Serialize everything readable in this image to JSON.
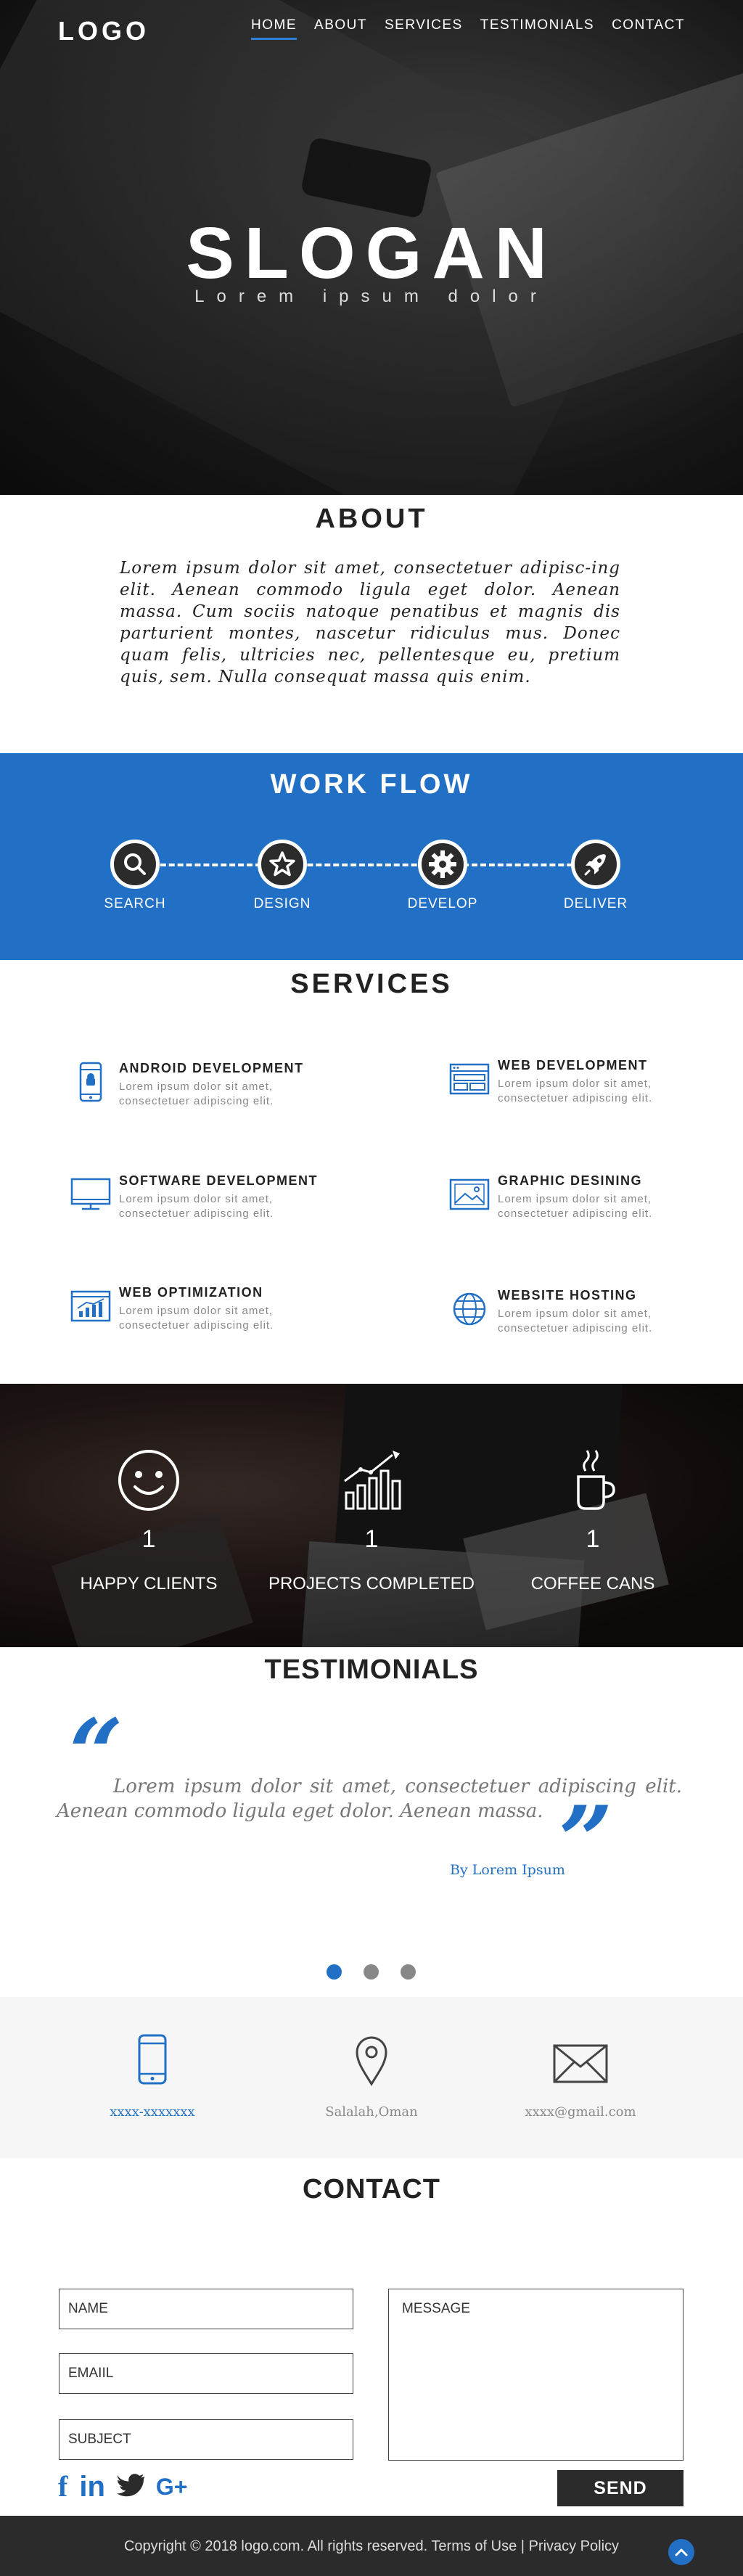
{
  "header": {
    "logo": "LOGO",
    "nav": [
      "HOME",
      "ABOUT",
      "SERVICES",
      "TESTIMONIALS",
      "CONTACT"
    ],
    "active_nav": "HOME"
  },
  "hero": {
    "slogan": "SLOGAN",
    "subtitle": "Lorem ipsum dolor",
    "slides": 3
  },
  "about": {
    "title": "ABOUT",
    "text": "Lorem ipsum dolor sit amet, consectetuer adipisc-ing elit. Aenean commodo ligula eget dolor. Aenean massa. Cum sociis natoque penatibus et magnis dis parturient montes, nascetur ridiculus mus. Donec quam felis, ultricies nec, pellentesque eu, pretium quis, sem. Nulla consequat massa quis enim."
  },
  "workflow": {
    "title": "WORK FLOW",
    "steps": [
      {
        "label": "SEARCH",
        "icon": "search-icon"
      },
      {
        "label": "DESIGN",
        "icon": "star-icon"
      },
      {
        "label": "DEVELOP",
        "icon": "gear-icon"
      },
      {
        "label": "DELIVER",
        "icon": "rocket-icon"
      }
    ]
  },
  "services": {
    "title": "SERVICES",
    "items": [
      {
        "title": "ANDROID DEVELOPMENT",
        "desc": "Lorem ipsum dolor sit amet, consectetuer adipiscing elit.",
        "icon": "android-phone-icon"
      },
      {
        "title": "WEB DEVELOPMENT",
        "desc": "Lorem ipsum dolor sit amet, consectetuer adipiscing elit.",
        "icon": "browser-window-icon"
      },
      {
        "title": "SOFTWARE DEVELOPMENT",
        "desc": "Lorem ipsum dolor sit amet, consectetuer adipiscing elit.",
        "icon": "monitor-icon"
      },
      {
        "title": "GRAPHIC DESINING",
        "desc": "Lorem ipsum dolor sit amet, consectetuer adipiscing elit.",
        "icon": "image-icon"
      },
      {
        "title": "WEB OPTIMIZATION",
        "desc": "Lorem ipsum dolor sit amet, consectetuer adipiscing elit.",
        "icon": "analytics-icon"
      },
      {
        "title": "WEBSITE HOSTING",
        "desc": "Lorem ipsum dolor sit amet, consectetuer adipiscing elit.",
        "icon": "globe-icon"
      }
    ]
  },
  "stats": [
    {
      "number": "1",
      "label": "HAPPY CLIENTS",
      "icon": "smiley-icon"
    },
    {
      "number": "1",
      "label": "PROJECTS COMPLETED",
      "icon": "bar-chart-icon"
    },
    {
      "number": "1",
      "label": "COFFEE CANS",
      "icon": "coffee-cup-icon"
    }
  ],
  "testimonials": {
    "title": "TESTIMONIALS",
    "quote": "Lorem ipsum dolor sit amet, consectetuer adipiscing elit. Aenean commodo ligula eget dolor. Aenean massa.",
    "author": "By Lorem Ipsum",
    "active_dot": 0
  },
  "info": {
    "phone": "xxxx-xxxxxxx",
    "location": "Salalah,Oman",
    "email": "xxxx@gmail.com"
  },
  "contact": {
    "title": "CONTACT",
    "name_placeholder": "NAME",
    "email_placeholder": "EMAIIL",
    "subject_placeholder": "SUBJECT",
    "message_placeholder": "MESSAGE",
    "send_label": "SEND",
    "social": [
      "facebook-icon",
      "linkedin-icon",
      "twitter-icon",
      "google-plus-icon"
    ],
    "social_text": [
      "f",
      "in",
      "G+"
    ]
  },
  "footer": {
    "copyright": "Copyright © 2018 logo.com. All rights reserved.",
    "terms": "Terms of Use",
    "separator": "|",
    "privacy": "Privacy Policy"
  },
  "colors": {
    "accent": "#2170c5",
    "dark": "#2b2b2b"
  }
}
